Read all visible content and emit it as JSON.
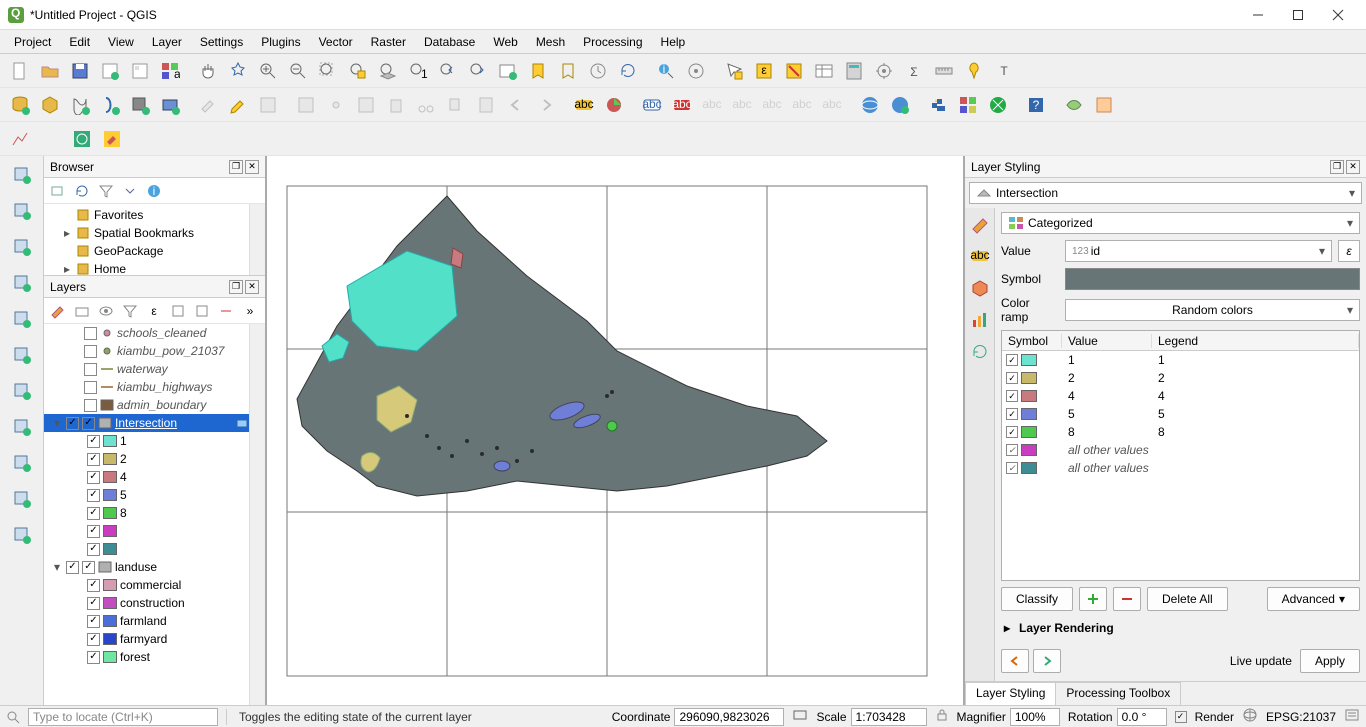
{
  "window": {
    "title": "*Untitled Project - QGIS"
  },
  "menu": [
    "Project",
    "Edit",
    "View",
    "Layer",
    "Settings",
    "Plugins",
    "Vector",
    "Raster",
    "Database",
    "Web",
    "Mesh",
    "Processing",
    "Help"
  ],
  "browser": {
    "title": "Browser",
    "items": [
      {
        "icon": "star",
        "label": "Favorites",
        "exp": ""
      },
      {
        "icon": "bookmark",
        "label": "Spatial Bookmarks",
        "exp": "▸"
      },
      {
        "icon": "geopkg",
        "label": "GeoPackage",
        "exp": ""
      },
      {
        "icon": "home",
        "label": "Home",
        "exp": "▸"
      }
    ]
  },
  "layers": {
    "title": "Layers",
    "tree": [
      {
        "type": "layer",
        "indent": 1,
        "checked": false,
        "style": "point",
        "color": "#d38ba1",
        "label": "schools_cleaned",
        "italic": true
      },
      {
        "type": "layer",
        "indent": 1,
        "checked": false,
        "style": "point",
        "color": "#8aa75a",
        "label": "kiambu_pow_21037",
        "italic": true
      },
      {
        "type": "layer",
        "indent": 1,
        "checked": false,
        "style": "line",
        "color": "#9aa56a",
        "label": "waterway",
        "italic": true
      },
      {
        "type": "layer",
        "indent": 1,
        "checked": false,
        "style": "line",
        "color": "#b58b63",
        "label": "kiambu_highways",
        "italic": true
      },
      {
        "type": "layer",
        "indent": 1,
        "checked": false,
        "style": "fill",
        "color": "#7a5b3e",
        "label": "admin_boundary",
        "italic": true
      },
      {
        "type": "layer",
        "indent": 0,
        "checked": true,
        "style": "fill",
        "color": "#b0b0b0",
        "label": "Intersection",
        "italic": false,
        "selected": true,
        "expand": "▾",
        "groupcb": true
      },
      {
        "type": "cat",
        "indent": 2,
        "checked": true,
        "color": "#6be3d0",
        "label": "1"
      },
      {
        "type": "cat",
        "indent": 2,
        "checked": true,
        "color": "#c8b86a",
        "label": "2"
      },
      {
        "type": "cat",
        "indent": 2,
        "checked": true,
        "color": "#c97a7e",
        "label": "4"
      },
      {
        "type": "cat",
        "indent": 2,
        "checked": true,
        "color": "#6f7fd8",
        "label": "5"
      },
      {
        "type": "cat",
        "indent": 2,
        "checked": true,
        "color": "#4ec94e",
        "label": "8"
      },
      {
        "type": "cat",
        "indent": 2,
        "checked": true,
        "color": "#c93ec0",
        "label": ""
      },
      {
        "type": "cat",
        "indent": 2,
        "checked": true,
        "color": "#3e8d94",
        "label": ""
      },
      {
        "type": "layer",
        "indent": 0,
        "checked": true,
        "style": "fill",
        "color": "#b0b0b0",
        "label": "landuse",
        "italic": false,
        "expand": "▾",
        "groupcb": true
      },
      {
        "type": "cat",
        "indent": 2,
        "checked": true,
        "color": "#d59bb0",
        "label": "commercial"
      },
      {
        "type": "cat",
        "indent": 2,
        "checked": true,
        "color": "#c24fc0",
        "label": "construction"
      },
      {
        "type": "cat",
        "indent": 2,
        "checked": true,
        "color": "#4a6fd6",
        "label": "farmland"
      },
      {
        "type": "cat",
        "indent": 2,
        "checked": true,
        "color": "#2a45c9",
        "label": "farmyard"
      },
      {
        "type": "cat",
        "indent": 2,
        "checked": true,
        "color": "#6fe6a2",
        "label": "forest"
      }
    ]
  },
  "layerStyling": {
    "title": "Layer Styling",
    "layer": "Intersection",
    "mode": "Categorized",
    "valueLabel": "Value",
    "valueField": "123 id",
    "symbolLabel": "Symbol",
    "rampLabel": "Color ramp",
    "rampValue": "Random colors",
    "cols": {
      "symbol": "Symbol",
      "value": "Value",
      "legend": "Legend"
    },
    "rows": [
      {
        "color": "#6be3d0",
        "value": "1",
        "legend": "1"
      },
      {
        "color": "#c8b86a",
        "value": "2",
        "legend": "2"
      },
      {
        "color": "#c97a7e",
        "value": "4",
        "legend": "4"
      },
      {
        "color": "#6f7fd8",
        "value": "5",
        "legend": "5"
      },
      {
        "color": "#4ec94e",
        "value": "8",
        "legend": "8"
      },
      {
        "color": "#c93ec0",
        "value": "all other values",
        "legend": "",
        "italic": true
      },
      {
        "color": "#3e8d94",
        "value": "all other values",
        "legend": "",
        "italic": true
      }
    ],
    "classify": "Classify",
    "deleteAll": "Delete All",
    "advanced": "Advanced",
    "layerRendering": "Layer Rendering",
    "liveUpdate": "Live update",
    "apply": "Apply",
    "tabs": [
      "Layer Styling",
      "Processing Toolbox"
    ]
  },
  "status": {
    "locator_placeholder": "Type to locate (Ctrl+K)",
    "message": "Toggles the editing state of the current layer",
    "coord_label": "Coordinate",
    "coord": "296090,9823026",
    "scale_label": "Scale",
    "scale": "1:703428",
    "mag_label": "Magnifier",
    "mag": "100%",
    "rot_label": "Rotation",
    "rot": "0.0 °",
    "render": "Render",
    "crs": "EPSG:21037"
  }
}
